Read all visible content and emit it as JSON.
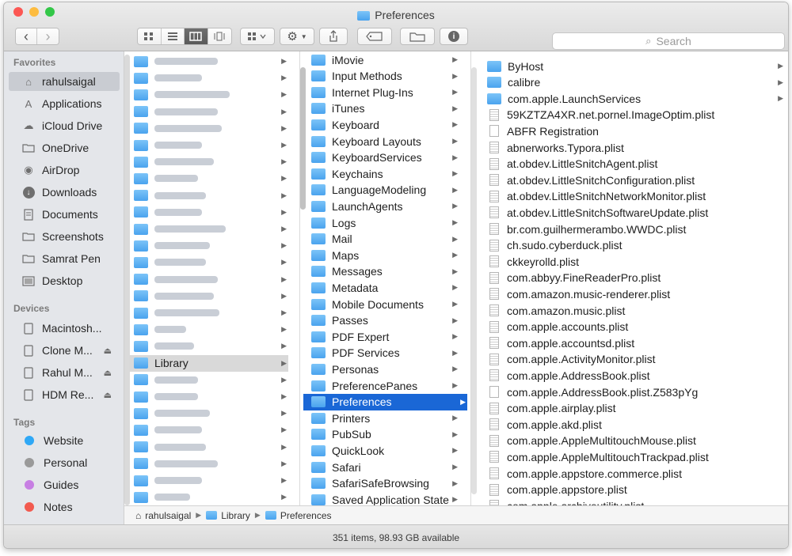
{
  "window": {
    "title": "Preferences",
    "traffic_colors": {
      "close": "#fc5753",
      "minimize": "#fdbc40",
      "zoom": "#33c748"
    }
  },
  "toolbar": {
    "back_glyph": "‹",
    "forward_glyph": "›",
    "search_placeholder": "Search",
    "active_view": "column-view",
    "icons": [
      "icon-view-icon",
      "list-view-icon",
      "column-view-icon",
      "cover-flow-icon",
      "arrange-icon",
      "action-gear-icon",
      "share-icon",
      "tag-icon",
      "new-folder-icon",
      "info-icon"
    ]
  },
  "sidebar": {
    "favorites_label": "Favorites",
    "favorites": [
      {
        "label": "rahulsaigal",
        "icon": "home-icon",
        "selected": true
      },
      {
        "label": "Applications",
        "icon": "applications-icon"
      },
      {
        "label": "iCloud Drive",
        "icon": "cloud-icon"
      },
      {
        "label": "OneDrive",
        "icon": "folder-icon"
      },
      {
        "label": "AirDrop",
        "icon": "airdrop-icon"
      },
      {
        "label": "Downloads",
        "icon": "downloads-icon"
      },
      {
        "label": "Documents",
        "icon": "documents-icon"
      },
      {
        "label": "Screenshots",
        "icon": "folder-icon"
      },
      {
        "label": "Samrat Pen",
        "icon": "folder-icon"
      },
      {
        "label": "Desktop",
        "icon": "desktop-icon"
      }
    ],
    "devices_label": "Devices",
    "devices": [
      {
        "label": "Macintosh...",
        "eject": false
      },
      {
        "label": "Clone M...",
        "eject": true
      },
      {
        "label": "Rahul M...",
        "eject": true
      },
      {
        "label": "HDM Re...",
        "eject": true
      }
    ],
    "tags_label": "Tags",
    "tags": [
      {
        "label": "Website",
        "color": "#2fa8f6"
      },
      {
        "label": "Personal",
        "color": "#9a9a9a"
      },
      {
        "label": "Guides",
        "color": "#c77fe3"
      },
      {
        "label": "Notes",
        "color": "#f25a4f"
      }
    ]
  },
  "column1": {
    "visible_label": "Library"
  },
  "column2": {
    "items": [
      "iMovie",
      "Input Methods",
      "Internet Plug-Ins",
      "iTunes",
      "Keyboard",
      "Keyboard Layouts",
      "KeyboardServices",
      "Keychains",
      "LanguageModeling",
      "LaunchAgents",
      "Logs",
      "Mail",
      "Maps",
      "Messages",
      "Metadata",
      "Mobile Documents",
      "Passes",
      "PDF Expert",
      "PDF Services",
      "Personas",
      "PreferencePanes",
      "Preferences",
      "Printers",
      "PubSub",
      "QuickLook",
      "Safari",
      "SafariSafeBrowsing",
      "Saved Application State"
    ],
    "selected": "Preferences"
  },
  "column3": {
    "items": [
      {
        "name": "ByHost",
        "kind": "folder"
      },
      {
        "name": "calibre",
        "kind": "folder"
      },
      {
        "name": "com.apple.LaunchServices",
        "kind": "folder"
      },
      {
        "name": "59KZTZA4XR.net.pornel.ImageOptim.plist",
        "kind": "plist"
      },
      {
        "name": "ABFR Registration",
        "kind": "doc"
      },
      {
        "name": "abnerworks.Typora.plist",
        "kind": "plist"
      },
      {
        "name": "at.obdev.LittleSnitchAgent.plist",
        "kind": "plist"
      },
      {
        "name": "at.obdev.LittleSnitchConfiguration.plist",
        "kind": "plist"
      },
      {
        "name": "at.obdev.LittleSnitchNetworkMonitor.plist",
        "kind": "plist"
      },
      {
        "name": "at.obdev.LittleSnitchSoftwareUpdate.plist",
        "kind": "plist"
      },
      {
        "name": "br.com.guilhermerambo.WWDC.plist",
        "kind": "plist"
      },
      {
        "name": "ch.sudo.cyberduck.plist",
        "kind": "plist"
      },
      {
        "name": "ckkeyrolld.plist",
        "kind": "plist"
      },
      {
        "name": "com.abbyy.FineReaderPro.plist",
        "kind": "plist"
      },
      {
        "name": "com.amazon.music-renderer.plist",
        "kind": "plist"
      },
      {
        "name": "com.amazon.music.plist",
        "kind": "plist"
      },
      {
        "name": "com.apple.accounts.plist",
        "kind": "plist"
      },
      {
        "name": "com.apple.accountsd.plist",
        "kind": "plist"
      },
      {
        "name": "com.apple.ActivityMonitor.plist",
        "kind": "plist"
      },
      {
        "name": "com.apple.AddressBook.plist",
        "kind": "plist"
      },
      {
        "name": "com.apple.AddressBook.plist.Z583pYg",
        "kind": "doc"
      },
      {
        "name": "com.apple.airplay.plist",
        "kind": "plist"
      },
      {
        "name": "com.apple.akd.plist",
        "kind": "plist"
      },
      {
        "name": "com.apple.AppleMultitouchMouse.plist",
        "kind": "plist"
      },
      {
        "name": "com.apple.AppleMultitouchTrackpad.plist",
        "kind": "plist"
      },
      {
        "name": "com.apple.appstore.commerce.plist",
        "kind": "plist"
      },
      {
        "name": "com.apple.appstore.plist",
        "kind": "plist"
      },
      {
        "name": "com.apple.archiveutility.plist",
        "kind": "plist"
      }
    ]
  },
  "pathbar": {
    "segments": [
      "rahulsaigal",
      "Library",
      "Preferences"
    ]
  },
  "status": {
    "text": "351 items, 98.93 GB available"
  }
}
